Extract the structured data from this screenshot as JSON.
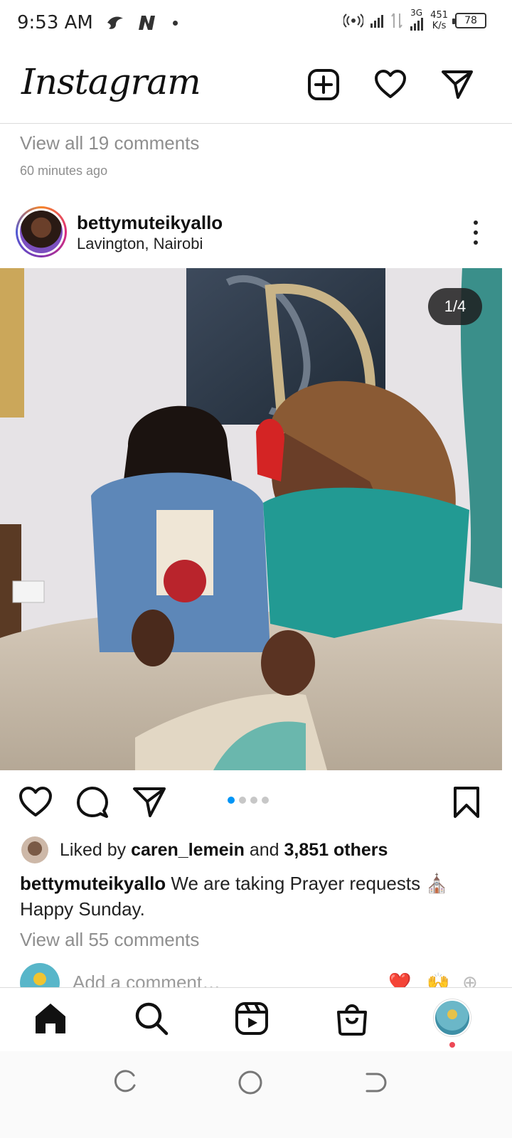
{
  "status_bar": {
    "time": "9:53 AM",
    "network_type": "3G",
    "net_speed_value": "451",
    "net_speed_unit": "K/s",
    "battery": "78"
  },
  "header": {
    "logo": "Instagram",
    "icons": [
      "plus-square-icon",
      "heart-icon",
      "direct-send-icon"
    ]
  },
  "previous_post": {
    "view_comments": "View all 19 comments",
    "time_ago": "60 minutes ago"
  },
  "post": {
    "username": "bettymuteikyallo",
    "location": "Lavington, Nairobi",
    "photo_counter": "1/4",
    "carousel": {
      "total": 4,
      "active": 1
    },
    "likes": {
      "prefix": "Liked by",
      "liker": "caren_lemein",
      "connector": "and",
      "others": "3,851 others"
    },
    "caption": {
      "username": "bettymuteikyallo",
      "text": "We are taking Prayer requests ⛪ Happy Sunday."
    },
    "view_comments": "View all 55 comments",
    "add_comment_placeholder": "Add a comment…",
    "quick_reactions": [
      "❤️",
      "🙌",
      "⊕"
    ]
  },
  "bottom_nav": {
    "items": [
      "home-icon",
      "search-icon",
      "reels-icon",
      "shop-icon",
      "profile-avatar"
    ]
  },
  "colors": {
    "accent_blue": "#0095f6",
    "notification_red": "#ed4956",
    "secondary_text": "#8e8e8e"
  }
}
